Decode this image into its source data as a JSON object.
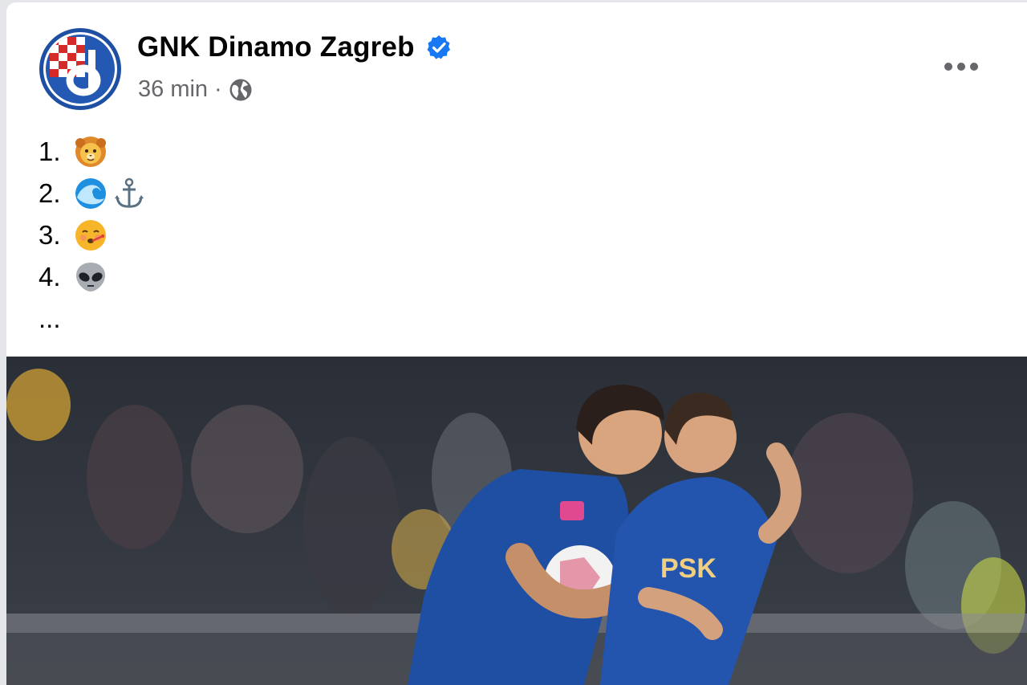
{
  "post": {
    "page_name": "GNK Dinamo Zagreb",
    "time": "36 min",
    "separator": "·",
    "privacy_icon": "globe-icon",
    "verified_icon": "verified-badge-icon",
    "more_icon": "more-options-icon",
    "lines": [
      {
        "number": "1.",
        "emojis": [
          "lion-face-emoji"
        ]
      },
      {
        "number": "2.",
        "emojis": [
          "water-wave-emoji",
          "anchor-emoji"
        ]
      },
      {
        "number": "3.",
        "emojis": [
          "face-with-thermometer-emoji"
        ]
      },
      {
        "number": "4.",
        "emojis": [
          "alien-emoji"
        ]
      }
    ],
    "ellipsis": "...",
    "photo": {
      "jersey_sponsor": "PSK"
    }
  },
  "colors": {
    "brand_blue": "#1877f2",
    "club_blue": "#1f4fa3",
    "meta_gray": "#65676b"
  }
}
